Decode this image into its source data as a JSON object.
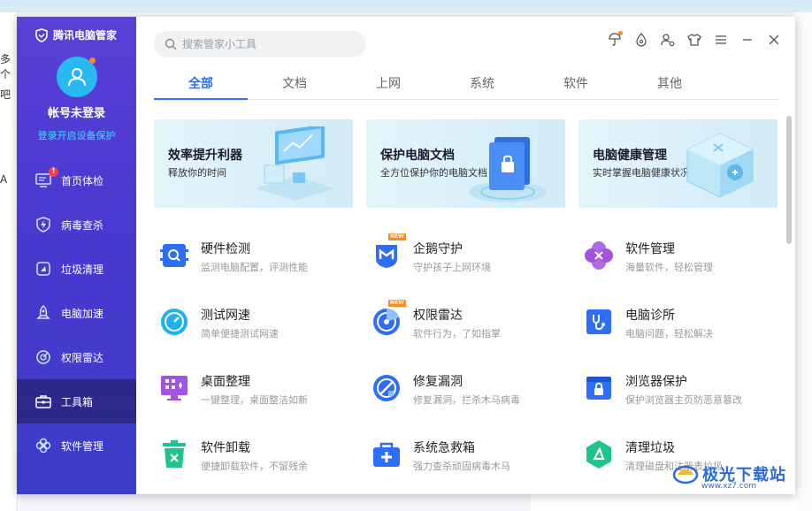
{
  "background": {
    "left_text_1": "多个",
    "left_text_2": "吧",
    "left_text_3": "A"
  },
  "sidebar": {
    "brand": "腾讯电脑管家",
    "account_name": "帐号未登录",
    "login_link": "登录开启设备保护",
    "items": [
      {
        "label": "首页体检",
        "icon": "monitor-check-icon"
      },
      {
        "label": "病毒查杀",
        "icon": "shield-bolt-icon"
      },
      {
        "label": "垃圾清理",
        "icon": "broom-icon"
      },
      {
        "label": "电脑加速",
        "icon": "rocket-icon"
      },
      {
        "label": "权限雷达",
        "icon": "radar-icon"
      },
      {
        "label": "工具箱",
        "icon": "toolbox-icon"
      },
      {
        "label": "软件管理",
        "icon": "apps-icon"
      }
    ],
    "active_index": 5,
    "badge": "!"
  },
  "search": {
    "placeholder": "搜索管家小工具"
  },
  "tabs": [
    "全部",
    "文档",
    "上网",
    "系统",
    "软件",
    "其他"
  ],
  "active_tab": 0,
  "banners": [
    {
      "title": "效率提升利器",
      "subtitle": "释放你的时间"
    },
    {
      "title": "保护电脑文档",
      "subtitle": "全方位保护你的电脑文档"
    },
    {
      "title": "电脑健康管理",
      "subtitle": "实时掌握电脑健康状况"
    }
  ],
  "tools": [
    {
      "title": "硬件检测",
      "desc": "监测电脑配置，评测性能",
      "icon": "hardware-check-icon",
      "new": false
    },
    {
      "title": "企鹅守护",
      "desc": "守护孩子上网环境",
      "icon": "penguin-guard-icon",
      "new": true
    },
    {
      "title": "软件管理",
      "desc": "海量软件，轻松管理",
      "icon": "software-manager-icon",
      "new": false
    },
    {
      "title": "测试网速",
      "desc": "简单便捷测试网速",
      "icon": "speedometer-icon",
      "new": false
    },
    {
      "title": "权限雷达",
      "desc": "软件行为，了如指掌",
      "icon": "permission-radar-icon",
      "new": true
    },
    {
      "title": "电脑诊所",
      "desc": "电脑问题，轻松解决",
      "icon": "stethoscope-icon",
      "new": false
    },
    {
      "title": "桌面整理",
      "desc": "一键整理，桌面整洁如新",
      "icon": "desktop-organize-icon",
      "new": false
    },
    {
      "title": "修复漏洞",
      "desc": "修复漏洞，拦杀木马病毒",
      "icon": "vulnerability-fix-icon",
      "new": false
    },
    {
      "title": "浏览器保护",
      "desc": "保护浏览器主页防恶意篡改",
      "icon": "browser-lock-icon",
      "new": false
    },
    {
      "title": "软件卸载",
      "desc": "便捷卸载软件，不留残余",
      "icon": "trash-uninstall-icon",
      "new": false
    },
    {
      "title": "系统急救箱",
      "desc": "强力查杀顽固病毒木马",
      "icon": "first-aid-kit-icon",
      "new": false
    },
    {
      "title": "清理垃圾",
      "desc": "清理磁盘和注册表垃圾",
      "icon": "clean-junk-icon",
      "new": false
    }
  ],
  "new_badge": "NEW",
  "watermark": {
    "text": "极光下载站",
    "url": "www.xz7.com"
  },
  "colors": {
    "accent": "#2e6df6",
    "sidebar_top": "#5a3fd6",
    "sidebar_bottom": "#3b3cc8",
    "login_link": "#38e0ff"
  }
}
